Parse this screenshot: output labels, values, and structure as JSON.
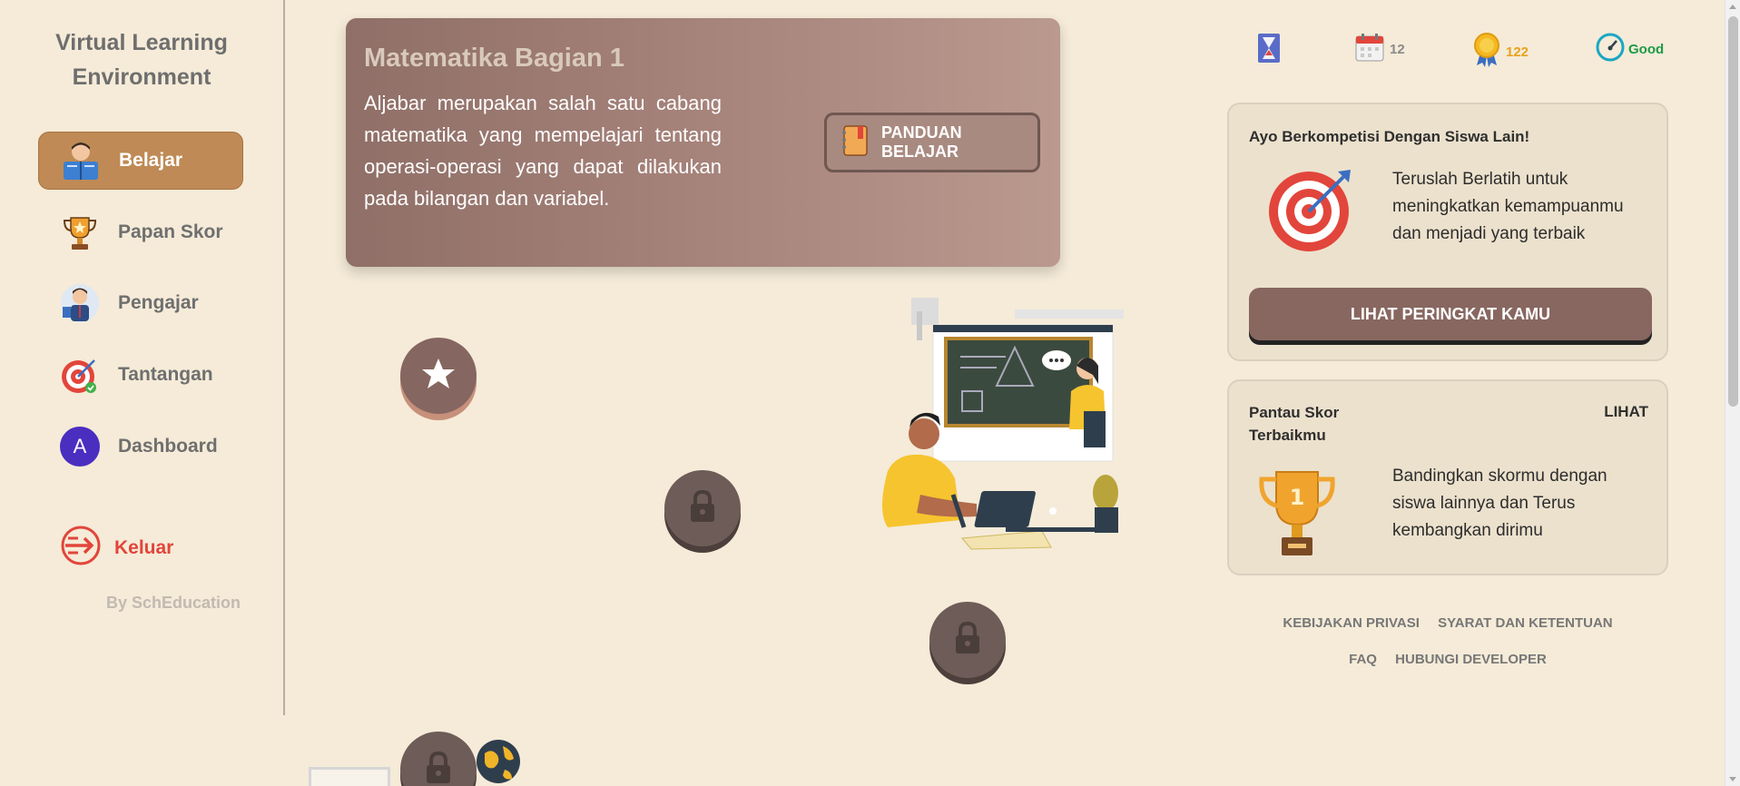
{
  "sidebar": {
    "brand_line1": "Virtual Learning",
    "brand_line2": "Environment",
    "items": [
      {
        "label": "Belajar",
        "icon": "student-reading-icon",
        "active": true
      },
      {
        "label": "Papan Skor",
        "icon": "trophy-icon",
        "active": false
      },
      {
        "label": "Pengajar",
        "icon": "teacher-icon",
        "active": false
      },
      {
        "label": "Tantangan",
        "icon": "target-icon",
        "active": false
      },
      {
        "label": "Dashboard",
        "icon": "avatar",
        "avatar_letter": "A",
        "active": false
      }
    ],
    "logout_label": "Keluar",
    "byline": "By SchEducation"
  },
  "lesson": {
    "title": "Matematika Bagian 1",
    "description": "Aljabar merupakan salah satu cabang matematika yang mempelajari tentang operasi-operasi yang dapat dilakukan pada bilangan dan variabel.",
    "guide_button": "PANDUAN BELAJAR"
  },
  "path_nodes": [
    {
      "state": "completed",
      "icon": "star-icon"
    },
    {
      "state": "locked",
      "icon": "lock-icon"
    },
    {
      "state": "locked",
      "icon": "lock-icon"
    },
    {
      "state": "locked",
      "icon": "lock-icon"
    }
  ],
  "stats": {
    "hourglass": {
      "icon": "hourglass-icon"
    },
    "streak": {
      "icon": "calendar-icon",
      "value": "12"
    },
    "points": {
      "icon": "medal-icon",
      "value": "122"
    },
    "status": {
      "icon": "speedometer-icon",
      "value": "Good"
    }
  },
  "compete_card": {
    "title": "Ayo Berkompetisi Dengan Siswa Lain!",
    "text": "Teruslah Berlatih untuk meningkatkan kemampuanmu dan menjadi yang terbaik",
    "button": "LIHAT PERINGKAT KAMU"
  },
  "score_card": {
    "title": "Pantau Skor Terbaikmu",
    "link": "LIHAT",
    "text": "Bandingkan skormu dengan siswa lainnya dan Terus kembangkan dirimu"
  },
  "footer": {
    "privacy": "KEBIJAKAN PRIVASI",
    "terms": "SYARAT DAN KETENTUAN",
    "faq": "FAQ",
    "contact": "HUBUNGI DEVELOPER"
  },
  "colors": {
    "background": "#f5ebd8",
    "active_nav": "#bf8a55",
    "lesson_card": "#a8857d",
    "node": "#6e5c58",
    "logout": "#e2453b",
    "points": "#e9a21b",
    "status_good": "#1c9a47"
  }
}
